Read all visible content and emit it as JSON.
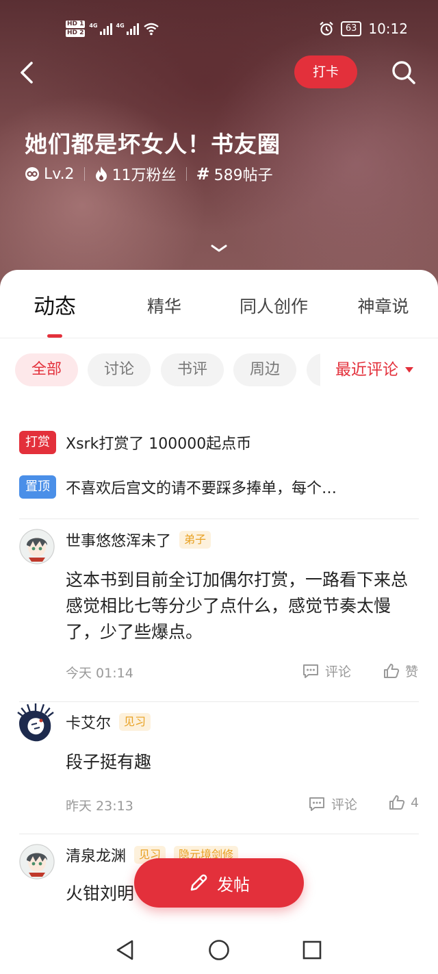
{
  "status_bar": {
    "hd1": "HD 1",
    "hd2": "HD 2",
    "net1": "4G",
    "net2": "4G",
    "battery": "63",
    "time": "10:12"
  },
  "header": {
    "checkin_label": "打卡",
    "title": "她们都是坏女人！书友圈",
    "level": "Lv.2",
    "fans": "11万粉丝",
    "posts": "589帖子"
  },
  "tabs": [
    {
      "label": "动态",
      "active": true
    },
    {
      "label": "精华",
      "active": false
    },
    {
      "label": "同人创作",
      "active": false
    },
    {
      "label": "神章说",
      "active": false
    }
  ],
  "filters": {
    "chips": [
      "全部",
      "讨论",
      "书评",
      "周边"
    ],
    "active": "全部",
    "sort_label": "最近评论"
  },
  "notices": [
    {
      "badge": "打赏",
      "text": "Xsrk打赏了 100000起点币"
    },
    {
      "badge": "置顶",
      "text": "不喜欢后宫文的请不要踩多捧单，每个…"
    }
  ],
  "posts": [
    {
      "author": "世事悠悠浑未了",
      "tag": "弟子",
      "body": "这本书到目前全订加偶尔打赏，一路看下来总感觉相比七等分少了点什么，感觉节奏太慢了，少了些爆点。",
      "time": "今天 01:14",
      "comment_label": "评论",
      "like_label": "赞"
    },
    {
      "author": "卡艾尔",
      "tag": "见习",
      "body": "段子挺有趣",
      "time": "昨天 23:13",
      "comment_label": "评论",
      "like_label": "4"
    },
    {
      "author": "清泉龙渊",
      "tag": "见习",
      "tag2": "隐元境剑修",
      "body": "火钳刘明"
    }
  ],
  "fab_label": "发帖",
  "colors": {
    "accent": "#e3303b",
    "tag_text": "#e8a020",
    "tag_bg": "#fdf1dc",
    "pin_blue": "#4a8fe8"
  }
}
